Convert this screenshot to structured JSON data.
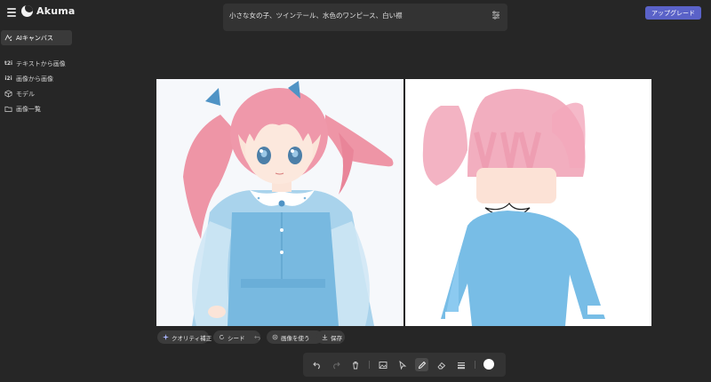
{
  "app": {
    "name": "Akuma"
  },
  "header": {
    "upgrade_label": "アップグレード"
  },
  "prompt": {
    "text": "小さな女の子、ツインテール、水色のワンピース、白い襟"
  },
  "sidebar": {
    "items": [
      {
        "label": "AIキャンバス",
        "icon": "ai-canvas-icon",
        "active": true
      },
      {
        "label": "テキストから画像",
        "icon": "t2i-icon",
        "badge": "t2i"
      },
      {
        "label": "画像から画像",
        "icon": "i2i-icon",
        "badge": "i2i"
      },
      {
        "label": "モデル",
        "icon": "cube-icon"
      },
      {
        "label": "画像一覧",
        "icon": "folder-icon"
      }
    ]
  },
  "actions": {
    "quality": "クオリティ補正",
    "seed": "シード",
    "use_image": "画像を使う",
    "save": "保存"
  },
  "toolbar": {
    "tools": [
      "undo-icon",
      "redo-icon",
      "trash-icon",
      "image-icon",
      "select-icon",
      "pencil-icon",
      "eraser-icon",
      "stroke-width-icon"
    ],
    "active_tool": "pencil-icon",
    "brush_color": "#ffffff"
  },
  "colors": {
    "accent": "#5a62c8",
    "background": "#262626",
    "panel": "#333333"
  }
}
